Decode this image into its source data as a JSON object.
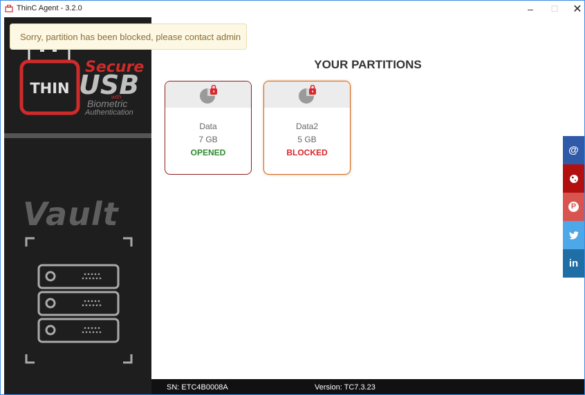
{
  "window": {
    "title": "ThinC Agent - 3.2.0",
    "minimize_glyph": "–",
    "maximize_glyph": "☐",
    "close_glyph": "✕"
  },
  "alert": {
    "message": "Sorry, partition has been blocked, please contact admin"
  },
  "sidebar": {
    "logo_thin": "THIN",
    "logo_secure": "Secure",
    "logo_usb": "USB",
    "logo_with": "with",
    "logo_biometric": "Biometric",
    "logo_authentication": "Authentication",
    "vault": "Vault"
  },
  "main": {
    "heading": "YOUR PARTITIONS",
    "partitions": [
      {
        "name": "Data",
        "size": "7 GB",
        "status": "OPENED",
        "icon": "partition-locked-icon"
      },
      {
        "name": "Data2",
        "size": "5 GB",
        "status": "BLOCKED",
        "icon": "partition-locked-icon"
      }
    ]
  },
  "statusbar": {
    "sn": "SN: ETC4B0008A",
    "version": "Version: TC7.3.23"
  },
  "social": {
    "email": "@",
    "globe_icon": "globe-icon",
    "pinterest": "P",
    "twitter_icon": "twitter-icon",
    "linkedin": "in"
  },
  "colors": {
    "accent_red": "#d02a2a",
    "opened_green": "#2e8b2e",
    "blocked_red": "#d9262b",
    "sidebar_bg": "#1e1e1e",
    "alert_bg": "#fcf8e3"
  }
}
